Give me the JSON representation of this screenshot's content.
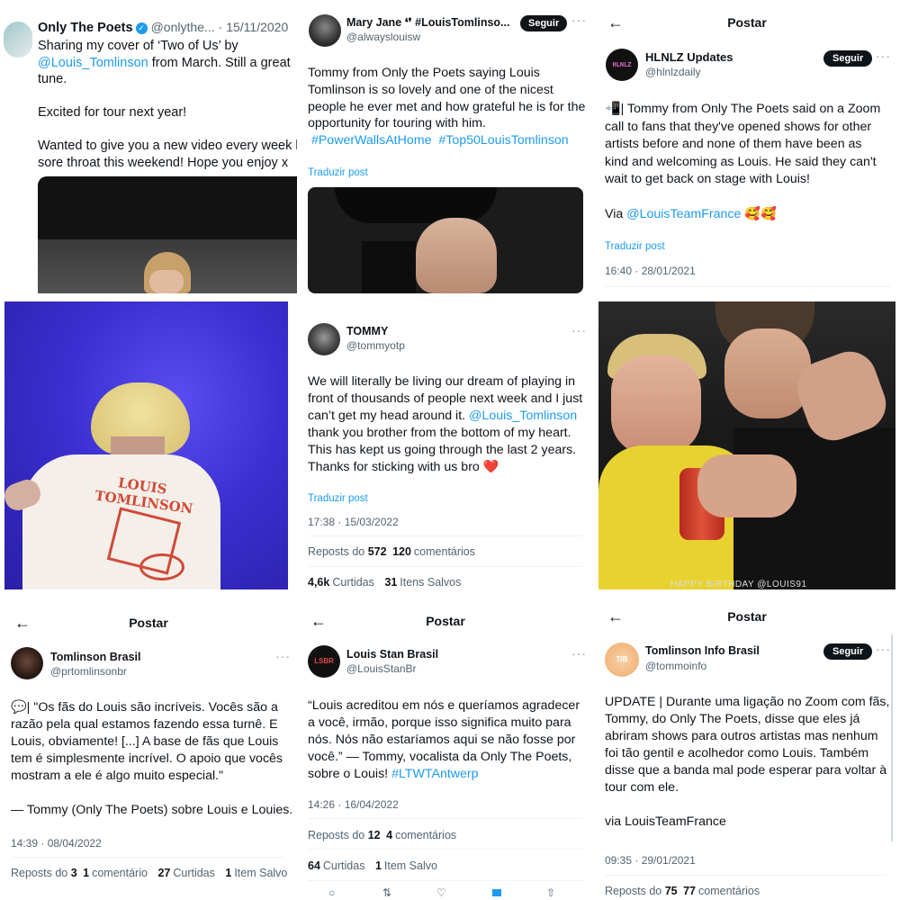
{
  "p1": {
    "name": "Only The Poets",
    "handle": "@onlythe...",
    "date": "· 15/11/2020",
    "lines": [
      [
        "Sharing my cover of ‘Two of Us’ by",
        ""
      ],
      [
        "",
        "@Louis_Tomlinson",
        " from March. Still a great"
      ],
      [
        "tune."
      ],
      [
        ""
      ],
      [
        "Excited for tour next year!"
      ],
      [
        ""
      ],
      [
        "Wanted to give you a new video every week b"
      ],
      [
        "sore throat this weekend! Hope you enjoy x"
      ]
    ],
    "l1": "Sharing my cover of ‘Two of Us’ by",
    "l2_mention": "@Louis_Tomlinson",
    "l2_rest": " from March. Still a great",
    "l3": "tune.",
    "l4": "Excited for tour next year!",
    "l5": "Wanted to give you a new video every week b",
    "l6": "sore throat this weekend! Hope you enjoy x"
  },
  "p2": {
    "name": "Mary Jane ❛❜ #LouisTomlinso...",
    "handle": "@alwayslouisw",
    "follow": "Seguir",
    "l1": "Tommy from Only the Poets saying Louis",
    "l2": "Tomlinson is so lovely and one of the nicest",
    "l3": "people he ever met and how grateful he is for the",
    "l4": "opportunity for touring with him.",
    "tag1": "#PowerWallsAtHome",
    "tag2": "#Top50LouisTomlinson",
    "translate": "Traduzir post"
  },
  "p3": {
    "header": "Postar",
    "name": "HLNLZ Updates",
    "handle": "@hlnlzdaily",
    "follow": "Seguir",
    "avatar_text": "HLNLZ",
    "l1": "📲| Tommy from Only The Poets said on a Zoom",
    "l2": "call to fans that they've opened shows for other",
    "l3": "artists before and none of them have been as",
    "l4": "kind and welcoming as Louis. He said they can't",
    "l5": "wait to get back on stage with Louis!",
    "via": "Via ",
    "via_mention": "@LouisTeamFrance",
    "via_emoji": " 🥰🥰",
    "translate": "Traduzir post",
    "stamp": "16:40 · 28/01/2021"
  },
  "p4": {
    "shirt_l1": "LOUIS",
    "shirt_l2": "TOMLINSON"
  },
  "p5": {
    "name": "TOMMY",
    "handle": "@tommyotp",
    "l1": "We will literally be living our dream of playing in",
    "l2": "front of thousands of people next week and I just",
    "l3_pre": "can’t get my head around it. ",
    "l3_mention": "@Louis_Tomlinson",
    "l4": "thank you brother from the bottom of my heart.",
    "l5": "This has kept us going through the last 2 years.",
    "l6": "Thanks for sticking with us bro ❤️",
    "translate": "Traduzir post",
    "stamp": "17:38 · 15/03/2022",
    "reposts_n": "572",
    "reposts_l": "Reposts do",
    "comments_n": "120",
    "comments_l": "comentários",
    "likes_n": "4,6k",
    "likes_l": "Curtidas",
    "saved_n": "31",
    "saved_l": "Itens Salvos"
  },
  "p6": {
    "caption": "HAPPY BIRTHDAY @LOUIS91"
  },
  "p7": {
    "header": "Postar",
    "name": "Tomlinson Brasil",
    "handle": "@prtomlinsonbr",
    "l1": "💬| \"Os fãs do Louis são incríveis. Vocês são a",
    "l2": "razão pela qual estamos fazendo essa turnê. E",
    "l3": "Louis, obviamente! [...] A base de fãs que Louis",
    "l4": "tem é simplesmente incrível. O apoio que vocês",
    "l5": "mostram a ele é algo muito especial.\"",
    "l6": "— Tommy (Only The Poets) sobre Louis e Louies.",
    "stamp": "14:39 · 08/04/2022",
    "reposts_l": "Reposts do",
    "reposts_n": "3",
    "comments_n": "1",
    "comments_l": "comentário",
    "likes_n": "27",
    "likes_l": "Curtidas",
    "saved_n": "1",
    "saved_l": "Item Salvo"
  },
  "p8": {
    "header": "Postar",
    "name": "Louis Stan Brasil",
    "handle": "@LouisStanBr",
    "avatar_text": "LSBR",
    "l1": "“Louis acreditou em nós e queríamos agradecer",
    "l2": "a você, irmão, porque isso significa muito para",
    "l3": "nós. Nós não estaríamos aqui se não fosse por",
    "l4": "você.” — Tommy, vocalista da Only The Poets,",
    "l5_pre": "sobre o Louis! ",
    "l5_tag": "#LTWTAntwerp",
    "stamp": "14:26 · 16/04/2022",
    "reposts_l": "Reposts do",
    "reposts_n": "12",
    "comments_n": "4",
    "comments_l": "comentários",
    "likes_n": "64",
    "likes_l": "Curtidas",
    "saved_n": "1",
    "saved_l": "Item Salvo"
  },
  "p9": {
    "header": "Postar",
    "name": "Tomlinson Info Brasil",
    "handle": "@tommoinfo",
    "follow": "Seguir",
    "avatar_text": "TIB",
    "l1": "UPDATE | Durante uma ligação no Zoom com fãs,",
    "l2": "Tommy, do Only The Poets, disse que eles já",
    "l3": "abriram shows para outros artistas mas nenhum",
    "l4": "foi tão gentil e acolhedor como Louis. Também",
    "l5": "disse que a banda mal pode esperar para voltar à",
    "l6": "tour com ele.",
    "via": "via LouisTeamFrance",
    "stamp": "09:35 · 29/01/2021",
    "reposts_l": "Reposts do",
    "reposts_n": "75",
    "comments_n": "77",
    "comments_l": "comentários"
  },
  "icons": {
    "back": "arrow-left-icon",
    "more": "more-dots-icon",
    "verified": "verified-badge-icon"
  },
  "colors": {
    "accent": "#1d9bf0",
    "text": "#0f1419",
    "muted": "#536471",
    "stage_blue": "#3a2fd0"
  }
}
